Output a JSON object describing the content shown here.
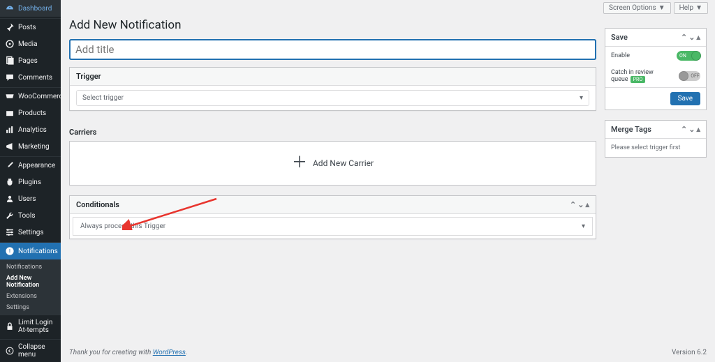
{
  "topbar": {
    "screen_options": "Screen Options",
    "help": "Help"
  },
  "sidebar": {
    "items": [
      {
        "name": "dashboard",
        "label": "Dashboard"
      },
      {
        "name": "posts",
        "label": "Posts"
      },
      {
        "name": "media",
        "label": "Media"
      },
      {
        "name": "pages",
        "label": "Pages"
      },
      {
        "name": "comments",
        "label": "Comments"
      },
      {
        "name": "woocommerce",
        "label": "WooCommerce"
      },
      {
        "name": "products",
        "label": "Products"
      },
      {
        "name": "analytics",
        "label": "Analytics"
      },
      {
        "name": "marketing",
        "label": "Marketing"
      },
      {
        "name": "appearance",
        "label": "Appearance"
      },
      {
        "name": "plugins",
        "label": "Plugins"
      },
      {
        "name": "users",
        "label": "Users"
      },
      {
        "name": "tools",
        "label": "Tools"
      },
      {
        "name": "settings",
        "label": "Settings"
      },
      {
        "name": "notifications",
        "label": "Notifications"
      },
      {
        "name": "limit-login",
        "label": "Limit Login At-tempts"
      }
    ],
    "submenu": {
      "notifications": [
        {
          "label": "Notifications"
        },
        {
          "label": "Add New Notification",
          "current": true
        },
        {
          "label": "Extensions"
        },
        {
          "label": "Settings"
        }
      ]
    },
    "collapse": "Collapse menu"
  },
  "page": {
    "heading": "Add New Notification",
    "title_placeholder": "Add title",
    "trigger": {
      "heading": "Trigger",
      "select": "Select trigger"
    },
    "carriers": {
      "heading": "Carriers",
      "add": "Add New Carrier"
    },
    "conditionals": {
      "heading": "Conditionals",
      "select": "Always process this Trigger"
    }
  },
  "save_box": {
    "title": "Save",
    "enable": "Enable",
    "enable_val": "ON",
    "review": "Catch in review queue",
    "pro": "PRO",
    "review_val": "OFF",
    "button": "Save"
  },
  "merge_box": {
    "title": "Merge Tags",
    "text": "Please select trigger first"
  },
  "footer": {
    "thanks": "Thank you for creating with ",
    "wp": "WordPress",
    "dot": ".",
    "version": "Version 6.2"
  }
}
